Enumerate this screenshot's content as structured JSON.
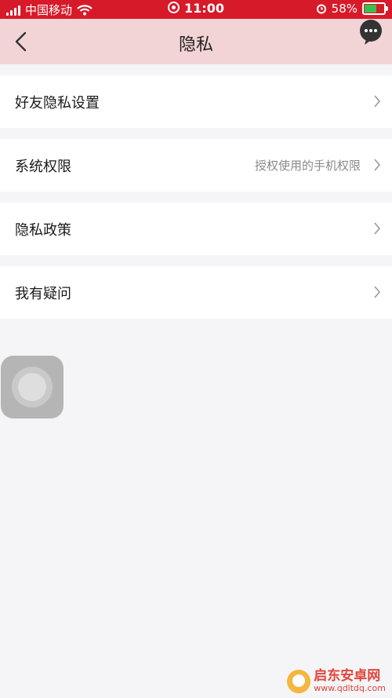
{
  "status_bar": {
    "carrier": "中国移动",
    "time": "11:00",
    "battery": "58%"
  },
  "nav": {
    "title": "隐私"
  },
  "items": [
    {
      "label": "好友隐私设置",
      "value": ""
    },
    {
      "label": "系统权限",
      "value": "授权使用的手机权限"
    },
    {
      "label": "隐私政策",
      "value": ""
    },
    {
      "label": "我有疑问",
      "value": ""
    }
  ],
  "watermark": {
    "name": "启东安卓网",
    "url": "www.qdltdq.com"
  },
  "colors": {
    "status_bar_bg": "#d71a29",
    "nav_bg": "#f2d4d6",
    "page_bg": "#f5f5f7"
  }
}
